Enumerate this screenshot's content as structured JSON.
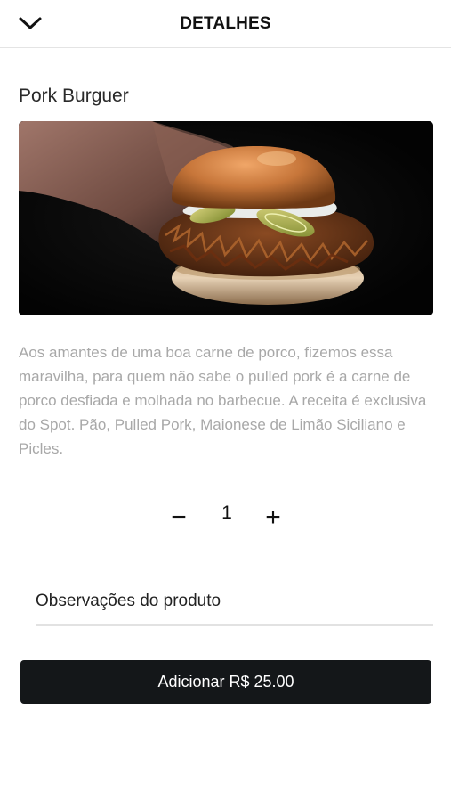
{
  "header": {
    "title": "DETALHES",
    "back_icon": "chevron-down-icon"
  },
  "product": {
    "name": "Pork Burguer",
    "image_alt": "Pork Burguer",
    "description": "Aos amantes de uma boa carne de porco, fizemos essa maravilha, para quem não sabe o pulled pork é a carne de porco desfiada e molhada no barbecue. A receita é exclusiva do Spot. Pão, Pulled Pork, Maionese de Limão Siciliano e Picles."
  },
  "quantity": {
    "minus_label": "−",
    "value": "1",
    "plus_label": "+"
  },
  "notes": {
    "placeholder": "Observações do produto",
    "value": ""
  },
  "add_button": {
    "label": "Adicionar",
    "price": "R$ 25.00"
  },
  "colors": {
    "button_bg": "#141719",
    "description_text": "#a8a8a8",
    "divider": "#e4e4e4"
  }
}
